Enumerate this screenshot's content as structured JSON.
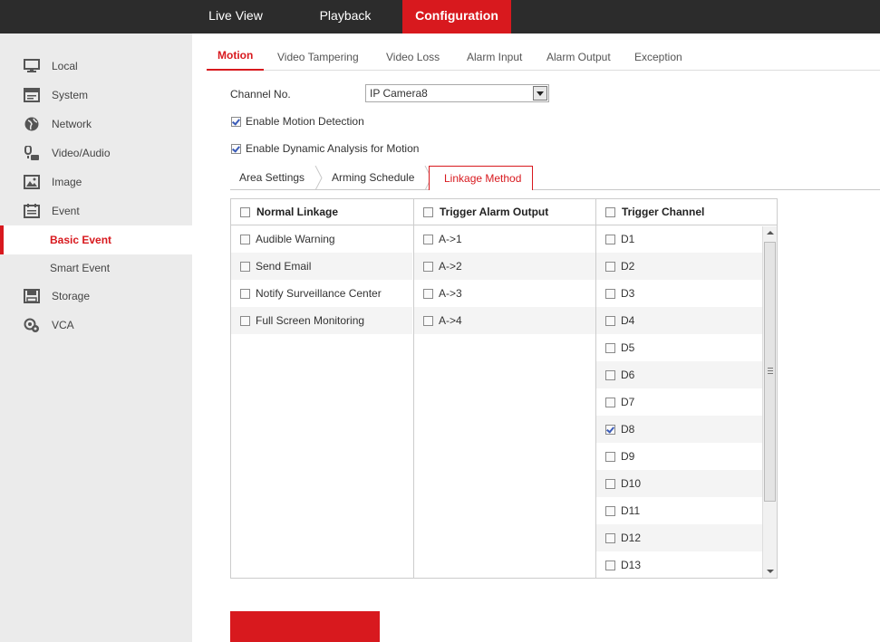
{
  "topnav": [
    {
      "label": "Live View"
    },
    {
      "label": "Playback"
    },
    {
      "label": "Configuration",
      "active": true
    }
  ],
  "sidebar": {
    "items": [
      {
        "label": "Local",
        "icon": "monitor-icon"
      },
      {
        "label": "System",
        "icon": "system-window-icon"
      },
      {
        "label": "Network",
        "icon": "globe-icon"
      },
      {
        "label": "Video/Audio",
        "icon": "microphone-camera-icon"
      },
      {
        "label": "Image",
        "icon": "image-icon"
      },
      {
        "label": "Event",
        "icon": "calendar-icon"
      },
      {
        "label": "Basic Event",
        "sub": true,
        "selected": true
      },
      {
        "label": "Smart Event",
        "sub": true
      },
      {
        "label": "Storage",
        "icon": "floppy-disk-icon"
      },
      {
        "label": "VCA",
        "icon": "vca-gear-icon"
      }
    ]
  },
  "tabs": [
    {
      "label": "Motion",
      "active": true
    },
    {
      "label": "Video Tampering"
    },
    {
      "label": "Video Loss"
    },
    {
      "label": "Alarm Input"
    },
    {
      "label": "Alarm Output"
    },
    {
      "label": "Exception"
    }
  ],
  "form": {
    "channel_label": "Channel No.",
    "channel_value": "IP Camera8",
    "enable_motion": {
      "label": "Enable Motion Detection",
      "checked": true
    },
    "enable_dynamic": {
      "label": "Enable Dynamic Analysis for Motion",
      "checked": true
    }
  },
  "subtabs": [
    {
      "label": "Area Settings"
    },
    {
      "label": "Arming Schedule"
    },
    {
      "label": "Linkage Method",
      "active": true
    }
  ],
  "linkage": {
    "normal": {
      "header": "Normal Linkage",
      "items": [
        "Audible Warning",
        "Send Email",
        "Notify Surveillance Center",
        "Full Screen Monitoring"
      ]
    },
    "alarm": {
      "header": "Trigger Alarm Output",
      "items": [
        "A->1",
        "A->2",
        "A->3",
        "A->4"
      ]
    },
    "channel": {
      "header": "Trigger Channel",
      "items": [
        "D1",
        "D2",
        "D3",
        "D4",
        "D5",
        "D6",
        "D7",
        "D8",
        "D9",
        "D10",
        "D11",
        "D12",
        "D13"
      ],
      "checked": [
        "D8"
      ]
    }
  },
  "colors": {
    "accent": "#d8191e",
    "topbar": "#2c2c2c",
    "sidebar": "#ebebeb"
  },
  "save": {
    "label": ""
  }
}
